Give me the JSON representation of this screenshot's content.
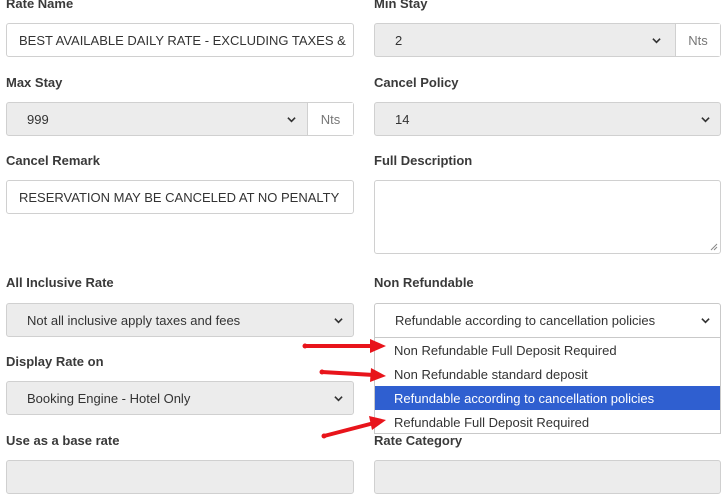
{
  "fields": {
    "rate_name": {
      "label": "Rate Name",
      "value": "BEST AVAILABLE DAILY RATE - EXCLUDING TAXES &"
    },
    "min_stay": {
      "label": "Min Stay",
      "value": "2",
      "unit": "Nts"
    },
    "max_stay": {
      "label": "Max Stay",
      "value": "999",
      "unit": "Nts"
    },
    "cancel_policy": {
      "label": "Cancel Policy",
      "value": "14"
    },
    "cancel_remark": {
      "label": "Cancel Remark",
      "value": "RESERVATION MAY BE CANCELED AT NO PENALTY"
    },
    "full_description": {
      "label": "Full Description",
      "value": ""
    },
    "all_inclusive_rate": {
      "label": "All Inclusive Rate",
      "value": "Not all inclusive apply taxes and fees"
    },
    "non_refundable": {
      "label": "Non Refundable",
      "value": "Refundable according to cancellation policies",
      "options": [
        "Non Refundable Full Deposit Required",
        "Non Refundable standard deposit",
        "Refundable according to cancellation policies",
        "Refundable Full Deposit Required"
      ],
      "selected_index": 2
    },
    "display_rate_on": {
      "label": "Display Rate on",
      "value": "Booking Engine - Hotel Only"
    },
    "use_as_base_rate": {
      "label": "Use as a base rate"
    },
    "rate_category": {
      "label": "Rate Category"
    }
  },
  "colors": {
    "highlight": "#2f5fd0",
    "annotation_arrow": "#e8141b",
    "select_bg": "#ececec"
  },
  "icons": {
    "chevron": "chevron-down-icon",
    "annotation": "red-arrow-icon"
  }
}
